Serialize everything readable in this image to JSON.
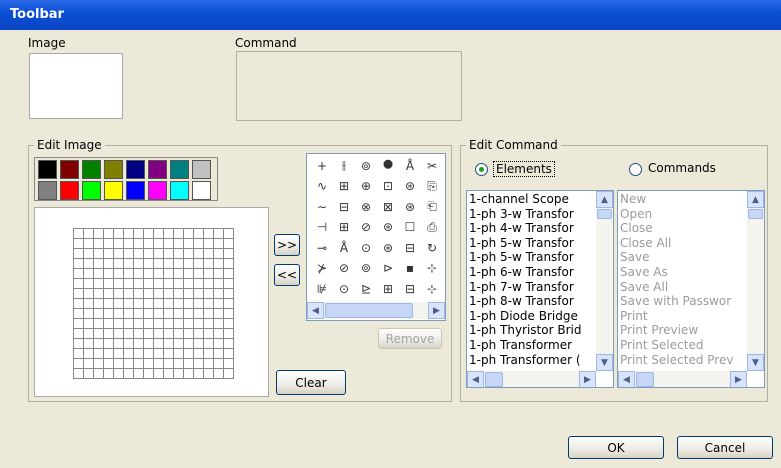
{
  "window": {
    "title": "Toolbar"
  },
  "labels": {
    "image": "Image",
    "command": "Command",
    "edit_image": "Edit Image",
    "edit_command": "Edit Command"
  },
  "palette": {
    "row1": [
      "#000000",
      "#800000",
      "#008000",
      "#808000",
      "#000080",
      "#800080",
      "#008080",
      "#c0c0c0"
    ],
    "row2": [
      "#808080",
      "#ff0000",
      "#00ff00",
      "#ffff00",
      "#0000ff",
      "#ff00ff",
      "#00ffff",
      "#ffffff"
    ]
  },
  "buttons": {
    "add": ">>",
    "remove_arrow": "<<",
    "remove": "Remove",
    "clear": "Clear",
    "ok": "OK",
    "cancel": "Cancel"
  },
  "radios": {
    "elements": "Elements",
    "commands": "Commands",
    "selected": "elements"
  },
  "icon_grid": {
    "rows": [
      [
        "+",
        "⫲",
        "⊚",
        "⯃",
        "Å",
        "✂"
      ],
      [
        "∿",
        "⊞",
        "⊕",
        "⊡",
        "⊛",
        "⎘"
      ],
      [
        "∼",
        "⊟",
        "⊗",
        "⊠",
        "⊛",
        "⎗"
      ],
      [
        "⊣",
        "⊞",
        "⊘",
        "⊛",
        "☐",
        "⎙"
      ],
      [
        "⊸",
        "Å",
        "⊙",
        "⊛",
        "⊟",
        "↻"
      ],
      [
        "⊁",
        "⊘",
        "⊚",
        "⊳",
        "▪",
        "⊹"
      ],
      [
        "⊯",
        "⊙",
        "⊵",
        "⊞",
        "⊟",
        "⊹"
      ]
    ]
  },
  "elements_list": [
    "1-channel Scope",
    "1-ph 3-w Transfor",
    "1-ph 4-w Transfor",
    "1-ph 5-w Transfor",
    "1-ph 5-w Transfor",
    "1-ph 6-w Transfor",
    "1-ph 7-w Transfor",
    "1-ph 8-w Transfor",
    "1-ph Diode Bridge",
    "1-ph Thyristor Brid",
    "1-ph Transformer",
    "1-ph Transformer ("
  ],
  "commands_list": [
    "New",
    "Open",
    "Close",
    "Close All",
    "Save",
    "Save As",
    "Save All",
    "Save with Passwor",
    "Print",
    "Print Preview",
    "Print Selected",
    "Print Selected Prev"
  ]
}
